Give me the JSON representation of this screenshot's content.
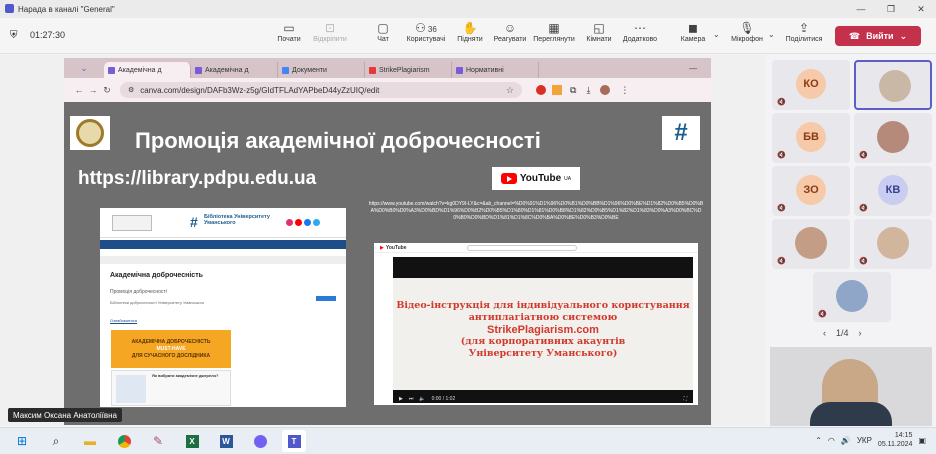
{
  "window": {
    "title": "Нарада в каналі \"General\"",
    "controls": [
      "—",
      "❐",
      "✕"
    ]
  },
  "toolbar": {
    "timer": "01:27:30",
    "buttons": [
      {
        "icon": "share-tray-icon",
        "label": "Почати",
        "enabled": true
      },
      {
        "icon": "record-icon",
        "label": "Відкріпити",
        "enabled": false
      },
      {
        "icon": "chat-icon",
        "label": "Чат",
        "enabled": true
      },
      {
        "icon": "people-icon",
        "label": "Користувачі",
        "count": "36",
        "enabled": true
      },
      {
        "icon": "raise-hand-icon",
        "label": "Підняти",
        "enabled": true
      },
      {
        "icon": "react-icon",
        "label": "Реагувати",
        "enabled": true
      },
      {
        "icon": "view-icon",
        "label": "Переглянути",
        "enabled": true
      },
      {
        "icon": "rooms-icon",
        "label": "Кімнати",
        "enabled": true
      },
      {
        "icon": "more-icon",
        "label": "Додатково",
        "enabled": true
      },
      {
        "icon": "camera-icon",
        "label": "Камера",
        "enabled": true
      },
      {
        "icon": "mic-icon",
        "label": "Мікрофон",
        "enabled": true
      },
      {
        "icon": "share-icon",
        "label": "Поділитися",
        "enabled": true
      }
    ],
    "leave_label": "Вийти"
  },
  "browser": {
    "tabs": [
      {
        "label": "Академічна д",
        "color": "#7b5cd6",
        "active": true
      },
      {
        "label": "Академічна д",
        "color": "#7b5cd6",
        "active": false
      },
      {
        "label": "Документи",
        "color": "#4285f4",
        "active": false
      },
      {
        "label": "StrikePlagiarism",
        "color": "#e53935",
        "active": false
      },
      {
        "label": "Нормативні",
        "color": "#7b5cd6",
        "active": false
      }
    ],
    "url": "canva.com/design/DAFb3Wz-z5g/GIdTFLAdYAPbeD44yZzUIQ/edit"
  },
  "slide": {
    "title": "Промоція академічної доброчесності",
    "library_url": "https://library.pdpu.edu.ua",
    "youtube_label": "YouTube",
    "youtube_sup": "UA",
    "youtube_link": "https://www.youtube.com/watch?v=kg0DY9I-LY&c=&ab_channel=%D0%91%D1%96%D0%B1%D0%BB%D1%96%D0%BE%D1%82%D0%B5%D0%BA%D0%B0%D0%A3%D0%BD%D1%96%D0%B2%D0%B5%D1%80%D1%81%D0%B8%D1%82%D0%B5%D1%82%D1%83%D0%A3%D0%BC%D0%B0%D0%BD%D1%81%D1%8C%D0%BA%D0%BE%D0%B3%D0%BE",
    "site": {
      "org": "Бібліотека Університету Уманського",
      "heading": "Академічна доброчесність",
      "subheading": "Промоція доброчесності",
      "note": "Бібліотеки доброчесності Університету Уманського",
      "link": "Ознайомитися",
      "banner_lines": [
        "АКАДЕМІЧНА ДОБРОЧЕСНІСТЬ",
        "MUST-HAVE",
        "ДЛЯ СУЧАСНОГО ДОСЛІДНИКА"
      ],
      "card_text": "Як вибрати академічне джерело?"
    },
    "video": {
      "lines": [
        "Відео-інструкція для індивідуального користування",
        "антиплагіатною системою",
        "StrikePlagiarism.com",
        "(для корпоративних акаунтів",
        "Університету Уманського)"
      ],
      "time": "0:00 / 1:02"
    }
  },
  "presenter_name": "Максим Оксана Анатоліївна",
  "participants": [
    {
      "initials": "КО",
      "bg": "#f6c9a8",
      "fg": "#8a3b12"
    },
    {
      "initials": "",
      "photo": true,
      "bg": "#c9b8a6"
    },
    {
      "initials": "БВ",
      "bg": "#f6c9a8",
      "fg": "#8a3b12"
    },
    {
      "initials": "",
      "photo": true,
      "bg": "#b58a7a"
    },
    {
      "initials": "ЗО",
      "bg": "#f6c9a8",
      "fg": "#8a3b12"
    },
    {
      "initials": "КВ",
      "bg": "#c8cdf1",
      "fg": "#3a3f8f"
    },
    {
      "initials": "",
      "photo": true,
      "bg": "#c49d86"
    },
    {
      "initials": "",
      "photo": true,
      "bg": "#d1b59c"
    },
    {
      "initials": "",
      "photo": true,
      "bg": "#8fa6c8"
    }
  ],
  "pager": {
    "label": "1/4",
    "prev": "‹",
    "next": "›"
  },
  "taskbar": {
    "apps": [
      "windows-icon",
      "search-icon",
      "file-explorer-icon",
      "chrome-icon",
      "paint-icon",
      "excel-icon",
      "word-icon",
      "viber-icon",
      "teams-icon"
    ],
    "language": "УКР",
    "time": "14:15",
    "date": "05.11.2024"
  }
}
